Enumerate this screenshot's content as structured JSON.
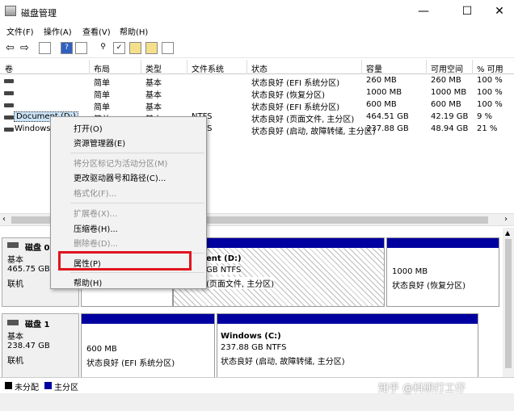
{
  "window": {
    "title": "磁盘管理",
    "min": "—",
    "max": "☐",
    "close": "✕"
  },
  "menu": [
    "文件(F)",
    "操作(A)",
    "查看(V)",
    "帮助(H)"
  ],
  "columns": [
    "卷",
    "布局",
    "类型",
    "文件系统",
    "状态",
    "容量",
    "可用空间",
    "% 可用"
  ],
  "rows": [
    {
      "vol": "",
      "layout": "简单",
      "type": "基本",
      "fs": "",
      "status": "状态良好 (EFI 系统分区)",
      "cap": "260 MB",
      "free": "260 MB",
      "pct": "100 %"
    },
    {
      "vol": "",
      "layout": "简单",
      "type": "基本",
      "fs": "",
      "status": "状态良好 (恢复分区)",
      "cap": "1000 MB",
      "free": "1000 MB",
      "pct": "100 %"
    },
    {
      "vol": "",
      "layout": "简单",
      "type": "基本",
      "fs": "",
      "status": "状态良好 (EFI 系统分区)",
      "cap": "600 MB",
      "free": "600 MB",
      "pct": "100 %"
    },
    {
      "vol": "Document (D:)",
      "layout": "简单",
      "type": "基本",
      "fs": "NTFS",
      "status": "状态良好 (页面文件, 主分区)",
      "cap": "464.51 GB",
      "free": "42.19 GB",
      "pct": "9 %"
    },
    {
      "vol": "Windows",
      "layout": "",
      "type": "",
      "fs": "NTFS",
      "status": "状态良好 (启动, 故障转储, 主分区)",
      "cap": "237.88 GB",
      "free": "48.94 GB",
      "pct": "21 %"
    }
  ],
  "context_menu": {
    "open": "打开(O)",
    "explorer": "资源管理器(E)",
    "mark_active": "将分区标记为活动分区(M)",
    "change_letter": "更改驱动器号和路径(C)...",
    "format": "格式化(F)...",
    "extend": "扩展卷(X)...",
    "shrink": "压缩卷(H)...",
    "delete": "删除卷(D)...",
    "properties": "属性(P)",
    "help": "帮助(H)"
  },
  "disks": [
    {
      "name": "磁盘 0",
      "type": "基本",
      "size": "465.75 GB",
      "status": "联机"
    },
    {
      "name": "磁盘 1",
      "type": "基本",
      "size": "238.47 GB",
      "status": "联机"
    }
  ],
  "partitions": {
    "d0_doc_title": "ent  (D:)",
    "d0_doc_line1": "GB NTFS",
    "d0_doc_line2": "(页面文件, 主分区)",
    "d0_rec_line1": "1000 MB",
    "d0_rec_line2": "状态良好 (恢复分区)",
    "d1_efi_line1": "600 MB",
    "d1_efi_line2": "状态良好 (EFI 系统分区)",
    "d1_win_title": "Windows  (C:)",
    "d1_win_line1": "237.88 GB NTFS",
    "d1_win_line2": "状态良好 (启动, 故障转储, 主分区)"
  },
  "legend": {
    "unallocated": "未分配",
    "primary": "主分区"
  },
  "watermark": "知乎 @科研打工仔",
  "colors": {
    "primary": "#0000a0",
    "highlight": "#e0141e"
  }
}
